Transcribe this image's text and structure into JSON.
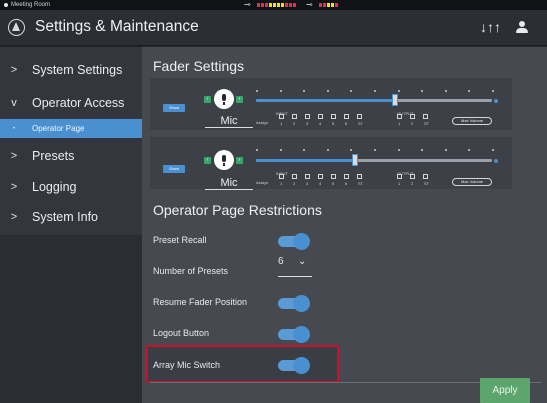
{
  "statusbar": {
    "room": "Meeting Room",
    "input_icon": "⊸",
    "output_icon": "⊸"
  },
  "titlebar": {
    "title": "Settings & Maintenance",
    "logo_icon": "audio-technica-logo",
    "mixer_icon_glyph": "↓↑↑",
    "user_icon": "user-icon"
  },
  "sidebar": {
    "items": [
      {
        "chevron": ">",
        "label": "System Settings"
      },
      {
        "chevron": "v",
        "label": "Operator Access"
      },
      {
        "chevron": "•",
        "label": "Operator Page"
      },
      {
        "chevron": ">",
        "label": "Presets"
      },
      {
        "chevron": ">",
        "label": "Logging"
      },
      {
        "chevron": ">",
        "label": "System Info"
      }
    ]
  },
  "fader_settings": {
    "title": "Fader Settings",
    "faders": [
      {
        "show_label": "Show",
        "name": "Mic",
        "assign_label": "Assign",
        "input_label": "INPUT",
        "output_label": "OUTPUT",
        "input_nums": [
          "1",
          "2",
          "3",
          "4",
          "5",
          "6",
          "ST"
        ],
        "output_nums": [
          "1",
          "2",
          "ST"
        ],
        "max_volume_label": "Max Volume",
        "level": 0.59
      },
      {
        "show_label": "Show",
        "name": "Mic",
        "assign_label": "Assign",
        "input_label": "INPUT",
        "output_label": "OUTPUT",
        "input_nums": [
          "1",
          "2",
          "3",
          "4",
          "5",
          "6",
          "ST"
        ],
        "output_nums": [
          "1",
          "2",
          "ST"
        ],
        "max_volume_label": "Max Volume",
        "level": 0.42
      }
    ]
  },
  "restrictions": {
    "title": "Operator Page Restrictions",
    "rows": [
      {
        "label": "Preset Recall",
        "on": true
      },
      {
        "label": "Number of Presets",
        "value": "6",
        "chevron": "⌄"
      },
      {
        "label": "Resume Fader Position",
        "on": true
      },
      {
        "label": "Logout Button",
        "on": true
      },
      {
        "label": "Array Mic Switch",
        "on": true
      }
    ]
  },
  "apply_label": "Apply",
  "colors": {
    "accent": "#4a8fd0",
    "apply": "#5ca66e",
    "highlight": "#c8122a"
  }
}
